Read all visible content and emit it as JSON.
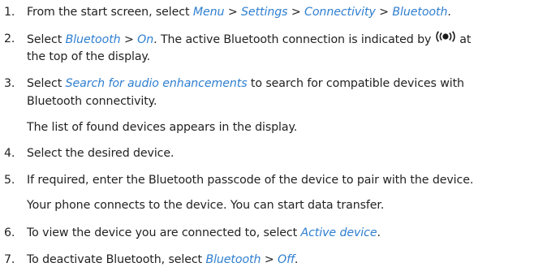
{
  "steps": [
    {
      "number": "1.",
      "parts": [
        "From the start screen, select ",
        "Menu",
        " > ",
        "Settings",
        " > ",
        "Connectivity",
        " > ",
        "Bluetooth",
        "."
      ]
    },
    {
      "number": "2.",
      "parts": [
        "Select ",
        "Bluetooth",
        " > ",
        "On",
        ". The active Bluetooth connection is indicated by",
        "at"
      ],
      "continuation": "the top of the display.",
      "icon": "bluetooth-active-icon"
    },
    {
      "number": "3.",
      "parts": [
        "Select ",
        "Search for audio enhancements",
        " to search for compatible devices with"
      ],
      "continuation": "Bluetooth connectivity.",
      "note": "The list of found devices appears in the display."
    },
    {
      "number": "4.",
      "text": "Select the desired device."
    },
    {
      "number": "5.",
      "text": "If required, enter the Bluetooth passcode of the device to pair with the device.",
      "note": "Your phone connects to the device. You can start data transfer."
    },
    {
      "number": "6.",
      "parts": [
        "To view the device you are connected to, select ",
        "Active device",
        "."
      ]
    },
    {
      "number": "7.",
      "parts": [
        "To deactivate Bluetooth, select ",
        "Bluetooth",
        " > ",
        "Off",
        "."
      ]
    }
  ],
  "colors": {
    "body_text": "#222222",
    "ui_link_text": "#2f7fd0"
  }
}
